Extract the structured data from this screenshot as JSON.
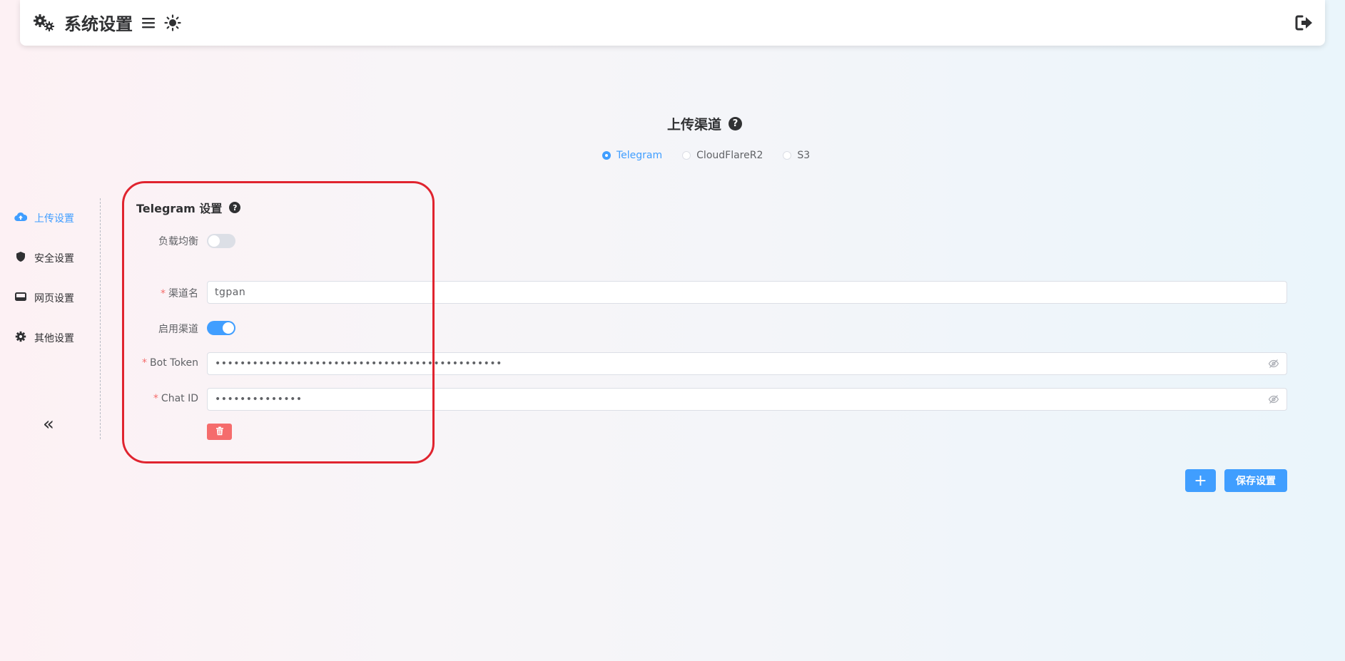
{
  "header": {
    "title": "系统设置",
    "icons": [
      "gears-icon",
      "menu-icon",
      "sun-icon",
      "logout-icon"
    ]
  },
  "sidebar": {
    "items": [
      {
        "label": "上传设置",
        "icon": "cloud-upload-icon",
        "active": true
      },
      {
        "label": "安全设置",
        "icon": "shield-icon",
        "active": false
      },
      {
        "label": "网页设置",
        "icon": "browser-icon",
        "active": false
      },
      {
        "label": "其他设置",
        "icon": "gear-icon",
        "active": false
      }
    ],
    "collapse_label": "«"
  },
  "upload_channel": {
    "title": "上传渠道",
    "options": [
      {
        "label": "Telegram",
        "checked": true
      },
      {
        "label": "CloudFlareR2",
        "checked": false
      },
      {
        "label": "S3",
        "checked": false
      }
    ]
  },
  "telegram": {
    "title": "Telegram 设置",
    "load_balance_label": "负载均衡",
    "load_balance_on": false,
    "channel_name_label": "渠道名",
    "channel_name_value": "tgpan",
    "enable_label": "启用渠道",
    "enable_on": true,
    "bot_token_label": "Bot Token",
    "bot_token_value": "••••••••••••••••••••••••••••••••••••••••••••••",
    "chat_id_label": "Chat ID",
    "chat_id_value": "••••••••••••••"
  },
  "actions": {
    "add_label": "+",
    "save_label": "保存设置"
  },
  "colors": {
    "accent": "#409eff",
    "danger": "#f56c6c",
    "highlight": "#e0242f"
  }
}
